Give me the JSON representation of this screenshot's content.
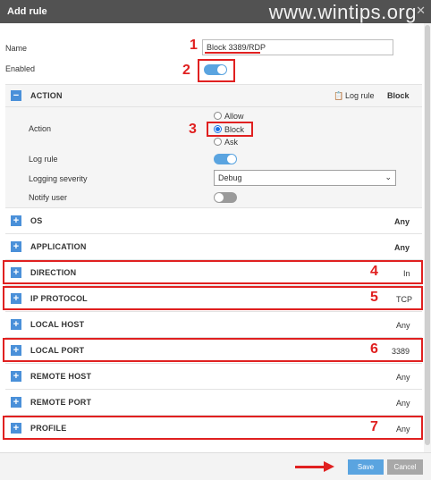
{
  "window": {
    "title": "Add rule",
    "watermark": "www.wintips.org",
    "close_icon": "close-icon"
  },
  "form": {
    "name_label": "Name",
    "name_value": "Block 3389/RDP",
    "enabled_label": "Enabled",
    "enabled": true
  },
  "action": {
    "section_title": "ACTION",
    "summary_log": "Log rule",
    "summary_value": "Block",
    "action_label": "Action",
    "options": [
      "Allow",
      "Block",
      "Ask"
    ],
    "selected": "Block",
    "log_rule_label": "Log rule",
    "log_rule": true,
    "logging_severity_label": "Logging severity",
    "logging_severity": "Debug",
    "notify_user_label": "Notify user",
    "notify_user": false
  },
  "sections": [
    {
      "title": "OS",
      "value": "Any"
    },
    {
      "title": "APPLICATION",
      "value": "Any"
    },
    {
      "title": "DIRECTION",
      "value": "In"
    },
    {
      "title": "IP PROTOCOL",
      "value": "TCP"
    },
    {
      "title": "LOCAL HOST",
      "value": "Any"
    },
    {
      "title": "LOCAL PORT",
      "value": "3389"
    },
    {
      "title": "REMOTE HOST",
      "value": "Any"
    },
    {
      "title": "REMOTE PORT",
      "value": "Any"
    },
    {
      "title": "PROFILE",
      "value": "Any"
    }
  ],
  "annotations": [
    "1",
    "2",
    "3",
    "4",
    "5",
    "6",
    "7"
  ],
  "footer": {
    "save_label": "Save",
    "cancel_label": "Cancel"
  },
  "colors": {
    "accent": "#5aa4e0",
    "highlight": "#e02020",
    "titlebar": "#525252"
  }
}
